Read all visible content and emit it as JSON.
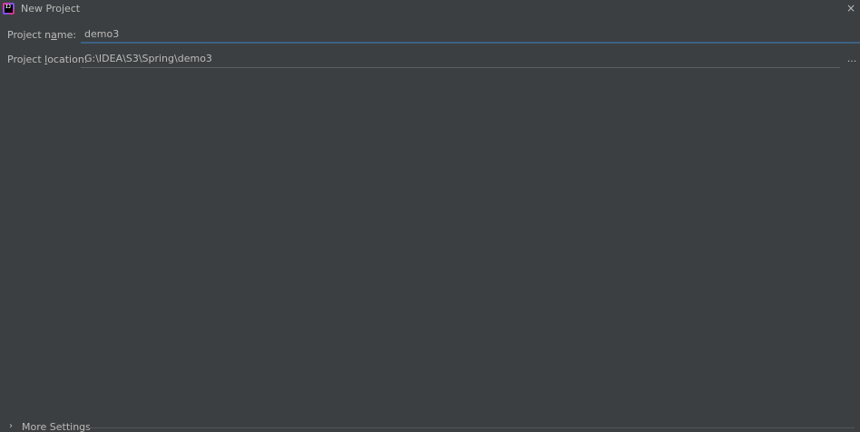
{
  "window": {
    "title": "New Project",
    "close_glyph": "×"
  },
  "form": {
    "project_name": {
      "label_pre": "Project n",
      "label_mnemonic": "a",
      "label_post": "me:",
      "value": "demo3"
    },
    "project_location": {
      "label_pre": "Project ",
      "label_mnemonic": "l",
      "label_post": "ocation:",
      "value": "G:\\IDEA\\S3\\Spring\\demo3",
      "browse_label": "..."
    }
  },
  "more_settings": {
    "label": "More Settings",
    "chevron": "›"
  },
  "icons": {
    "app": "intellij-idea-icon",
    "close": "close-icon",
    "expand": "chevron-right-icon"
  },
  "colors": {
    "background": "#3c3f41",
    "text": "#bbbbbb",
    "focus_underline": "#3d6185"
  }
}
